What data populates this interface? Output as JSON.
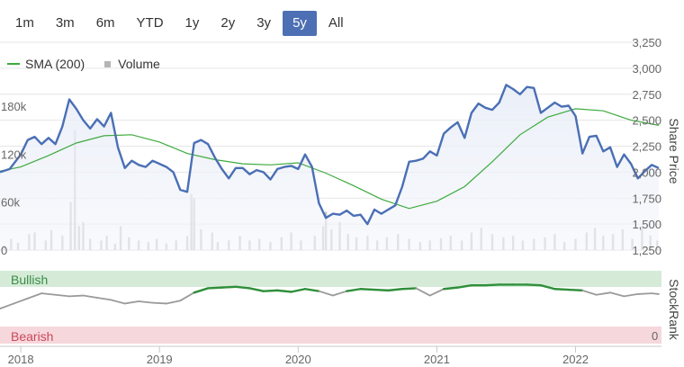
{
  "range_buttons": [
    {
      "label": "1m",
      "active": false
    },
    {
      "label": "3m",
      "active": false
    },
    {
      "label": "6m",
      "active": false
    },
    {
      "label": "YTD",
      "active": false
    },
    {
      "label": "1y",
      "active": false
    },
    {
      "label": "2y",
      "active": false
    },
    {
      "label": "3y",
      "active": false
    },
    {
      "label": "5y",
      "active": true
    },
    {
      "label": "All",
      "active": false
    }
  ],
  "legend": {
    "sma_label": "SMA (200)",
    "volume_label": "Volume"
  },
  "colors": {
    "price": "#4a6fb5",
    "sma": "#3daa3d",
    "volume": "#c4c4c4",
    "bullish_bg": "#d5ebd8",
    "bearish_bg": "#f6d7dc",
    "stockrank_bull": "#2f8f3a",
    "stockrank_neutral": "#9a9a9a",
    "active_button": "#4d6fb4"
  },
  "chart_data": {
    "type": "line",
    "x_range": [
      2017.85,
      2022.62
    ],
    "x_ticks": [
      "2018",
      "2019",
      "2020",
      "2021",
      "2022"
    ],
    "x_tick_values": [
      2018.0,
      2019.0,
      2020.0,
      2021.0,
      2022.0
    ],
    "price_axis": {
      "label": "Share Price",
      "ylim": [
        1250,
        3250
      ],
      "ticks": [
        "1,250",
        "1,500",
        "1,750",
        "2,000",
        "2,250",
        "2,500",
        "2,750",
        "3,000",
        "3,250"
      ],
      "tick_values": [
        1250,
        1500,
        1750,
        2000,
        2250,
        2500,
        2750,
        3000,
        3250
      ]
    },
    "volume_axis": {
      "ylim": [
        0,
        260000
      ],
      "ticks": [
        "0",
        "60k",
        "120k",
        "180k"
      ],
      "tick_values": [
        0,
        60000,
        120000,
        180000
      ]
    },
    "stockrank_axis": {
      "label": "StockRank",
      "ylim": [
        0,
        100
      ],
      "bullish_label": "Bullish",
      "bearish_label": "Bearish",
      "zero_label": "0",
      "bullish_threshold": 70,
      "bearish_threshold": 30
    },
    "series": [
      {
        "name": "Share Price",
        "x": [
          2017.85,
          2017.92,
          2018.0,
          2018.05,
          2018.1,
          2018.15,
          2018.2,
          2018.25,
          2018.3,
          2018.35,
          2018.4,
          2018.45,
          2018.5,
          2018.55,
          2018.6,
          2018.65,
          2018.7,
          2018.75,
          2018.8,
          2018.85,
          2018.9,
          2018.95,
          2019.0,
          2019.05,
          2019.1,
          2019.15,
          2019.2,
          2019.25,
          2019.3,
          2019.35,
          2019.4,
          2019.45,
          2019.5,
          2019.55,
          2019.6,
          2019.65,
          2019.7,
          2019.75,
          2019.8,
          2019.85,
          2019.9,
          2019.95,
          2020.0,
          2020.05,
          2020.1,
          2020.15,
          2020.2,
          2020.25,
          2020.3,
          2020.35,
          2020.4,
          2020.45,
          2020.5,
          2020.55,
          2020.6,
          2020.65,
          2020.7,
          2020.75,
          2020.8,
          2020.85,
          2020.9,
          2020.95,
          2021.0,
          2021.05,
          2021.1,
          2021.15,
          2021.2,
          2021.25,
          2021.3,
          2021.35,
          2021.4,
          2021.45,
          2021.5,
          2021.55,
          2021.6,
          2021.65,
          2021.7,
          2021.75,
          2021.8,
          2021.85,
          2021.9,
          2021.95,
          2022.0,
          2022.05,
          2022.1,
          2022.15,
          2022.2,
          2022.25,
          2022.3,
          2022.35,
          2022.4,
          2022.45,
          2022.5,
          2022.55,
          2022.6
        ],
        "values": [
          2000,
          2030,
          2170,
          2310,
          2340,
          2270,
          2330,
          2270,
          2440,
          2700,
          2610,
          2500,
          2420,
          2510,
          2440,
          2570,
          2240,
          2040,
          2110,
          2070,
          2050,
          2110,
          2080,
          2050,
          2000,
          1830,
          1810,
          2280,
          2310,
          2270,
          2140,
          2030,
          1940,
          2040,
          2040,
          1980,
          2020,
          2000,
          1930,
          2030,
          2050,
          2060,
          2030,
          2170,
          2050,
          1700,
          1560,
          1600,
          1590,
          1630,
          1580,
          1590,
          1500,
          1640,
          1600,
          1640,
          1680,
          1860,
          2100,
          2110,
          2130,
          2200,
          2160,
          2370,
          2430,
          2480,
          2330,
          2570,
          2660,
          2620,
          2600,
          2670,
          2840,
          2800,
          2750,
          2820,
          2810,
          2570,
          2620,
          2670,
          2630,
          2640,
          2540,
          2180,
          2340,
          2350,
          2200,
          2240,
          2050,
          2170,
          2080,
          1940,
          2010,
          2070,
          2040
        ]
      },
      {
        "name": "SMA (200)",
        "x": [
          2017.85,
          2018.0,
          2018.2,
          2018.4,
          2018.6,
          2018.8,
          2019.0,
          2019.2,
          2019.4,
          2019.6,
          2019.8,
          2020.0,
          2020.2,
          2020.4,
          2020.6,
          2020.8,
          2021.0,
          2021.2,
          2021.4,
          2021.6,
          2021.8,
          2022.0,
          2022.2,
          2022.4,
          2022.6
        ],
        "values": [
          2010,
          2050,
          2160,
          2280,
          2350,
          2360,
          2290,
          2180,
          2120,
          2080,
          2070,
          2090,
          1990,
          1870,
          1740,
          1650,
          1720,
          1860,
          2100,
          2360,
          2530,
          2610,
          2590,
          2500,
          2450
        ]
      },
      {
        "name": "StockRank",
        "x": [
          2017.85,
          2017.95,
          2018.05,
          2018.15,
          2018.25,
          2018.35,
          2018.45,
          2018.55,
          2018.65,
          2018.75,
          2018.85,
          2018.95,
          2019.05,
          2019.15,
          2019.25,
          2019.35,
          2019.45,
          2019.55,
          2019.65,
          2019.75,
          2019.85,
          2019.95,
          2020.05,
          2020.15,
          2020.25,
          2020.35,
          2020.45,
          2020.55,
          2020.65,
          2020.75,
          2020.85,
          2020.95,
          2021.05,
          2021.15,
          2021.25,
          2021.35,
          2021.45,
          2021.55,
          2021.65,
          2021.75,
          2021.85,
          2021.95,
          2022.05,
          2022.15,
          2022.25,
          2022.35,
          2022.45,
          2022.55,
          2022.6
        ],
        "values": [
          48,
          55,
          62,
          69,
          67,
          65,
          66,
          63,
          60,
          55,
          58,
          56,
          55,
          59,
          70,
          76,
          77,
          78,
          76,
          72,
          73,
          71,
          75,
          72,
          66,
          72,
          75,
          74,
          73,
          75,
          76,
          66,
          75,
          77,
          80,
          80,
          81,
          81,
          81,
          80,
          75,
          74,
          73,
          67,
          70,
          65,
          68,
          69,
          68
        ]
      }
    ],
    "volume_bars": [
      {
        "x": 2017.88,
        "v": 6000
      },
      {
        "x": 2017.93,
        "v": 14000
      },
      {
        "x": 2017.98,
        "v": 9000
      },
      {
        "x": 2018.06,
        "v": 20000
      },
      {
        "x": 2018.1,
        "v": 22000
      },
      {
        "x": 2018.18,
        "v": 12000
      },
      {
        "x": 2018.22,
        "v": 25000
      },
      {
        "x": 2018.3,
        "v": 18000
      },
      {
        "x": 2018.36,
        "v": 60000
      },
      {
        "x": 2018.39,
        "v": 150000
      },
      {
        "x": 2018.42,
        "v": 30000
      },
      {
        "x": 2018.45,
        "v": 35000
      },
      {
        "x": 2018.5,
        "v": 14000
      },
      {
        "x": 2018.58,
        "v": 12000
      },
      {
        "x": 2018.62,
        "v": 18000
      },
      {
        "x": 2018.68,
        "v": 8000
      },
      {
        "x": 2018.72,
        "v": 30000
      },
      {
        "x": 2018.78,
        "v": 16000
      },
      {
        "x": 2018.85,
        "v": 12000
      },
      {
        "x": 2018.92,
        "v": 10000
      },
      {
        "x": 2018.98,
        "v": 14000
      },
      {
        "x": 2019.05,
        "v": 8000
      },
      {
        "x": 2019.12,
        "v": 12000
      },
      {
        "x": 2019.2,
        "v": 18000
      },
      {
        "x": 2019.23,
        "v": 70000
      },
      {
        "x": 2019.25,
        "v": 65000
      },
      {
        "x": 2019.3,
        "v": 26000
      },
      {
        "x": 2019.38,
        "v": 22000
      },
      {
        "x": 2019.42,
        "v": 10000
      },
      {
        "x": 2019.5,
        "v": 12000
      },
      {
        "x": 2019.58,
        "v": 18000
      },
      {
        "x": 2019.65,
        "v": 12000
      },
      {
        "x": 2019.72,
        "v": 14000
      },
      {
        "x": 2019.8,
        "v": 10000
      },
      {
        "x": 2019.88,
        "v": 16000
      },
      {
        "x": 2019.95,
        "v": 22000
      },
      {
        "x": 2020.02,
        "v": 12000
      },
      {
        "x": 2020.12,
        "v": 18000
      },
      {
        "x": 2020.18,
        "v": 30000
      },
      {
        "x": 2020.2,
        "v": 48000
      },
      {
        "x": 2020.24,
        "v": 26000
      },
      {
        "x": 2020.3,
        "v": 35000
      },
      {
        "x": 2020.36,
        "v": 20000
      },
      {
        "x": 2020.42,
        "v": 16000
      },
      {
        "x": 2020.5,
        "v": 18000
      },
      {
        "x": 2020.57,
        "v": 12000
      },
      {
        "x": 2020.64,
        "v": 16000
      },
      {
        "x": 2020.72,
        "v": 20000
      },
      {
        "x": 2020.8,
        "v": 14000
      },
      {
        "x": 2020.88,
        "v": 10000
      },
      {
        "x": 2020.95,
        "v": 12000
      },
      {
        "x": 2021.03,
        "v": 15000
      },
      {
        "x": 2021.1,
        "v": 18000
      },
      {
        "x": 2021.18,
        "v": 12000
      },
      {
        "x": 2021.25,
        "v": 22000
      },
      {
        "x": 2021.32,
        "v": 28000
      },
      {
        "x": 2021.4,
        "v": 20000
      },
      {
        "x": 2021.48,
        "v": 16000
      },
      {
        "x": 2021.55,
        "v": 18000
      },
      {
        "x": 2021.62,
        "v": 12000
      },
      {
        "x": 2021.7,
        "v": 14000
      },
      {
        "x": 2021.78,
        "v": 16000
      },
      {
        "x": 2021.85,
        "v": 20000
      },
      {
        "x": 2021.92,
        "v": 10000
      },
      {
        "x": 2022.0,
        "v": 14000
      },
      {
        "x": 2022.08,
        "v": 22000
      },
      {
        "x": 2022.14,
        "v": 28000
      },
      {
        "x": 2022.2,
        "v": 18000
      },
      {
        "x": 2022.27,
        "v": 20000
      },
      {
        "x": 2022.34,
        "v": 26000
      },
      {
        "x": 2022.41,
        "v": 14000
      },
      {
        "x": 2022.48,
        "v": 30000
      },
      {
        "x": 2022.54,
        "v": 18000
      },
      {
        "x": 2022.59,
        "v": 12000
      }
    ]
  }
}
